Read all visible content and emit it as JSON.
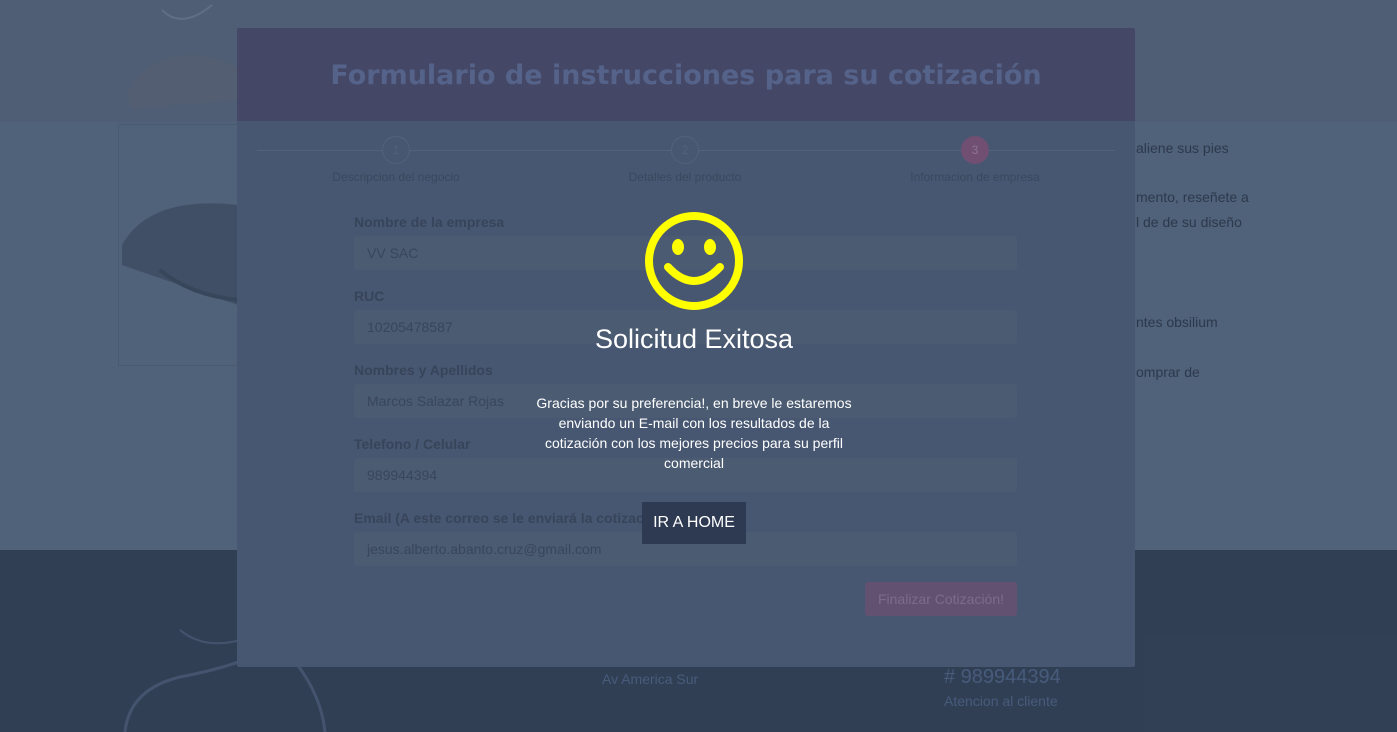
{
  "background": {
    "right_text": [
      "aliene sus pies",
      "mento, reseñete a",
      "l de de su diseño",
      "ntes obsilium",
      "omprar de"
    ],
    "address": "Av America Sur",
    "phone": "# 989944394",
    "attention": "Atencion al cliente"
  },
  "form": {
    "title": "Formulario de instrucciones para su cotización",
    "steps": [
      {
        "number": "1",
        "label": "Descripcion del negocio"
      },
      {
        "number": "2",
        "label": "Detalles del producto"
      },
      {
        "number": "3",
        "label": "Informacion de empresa"
      }
    ],
    "fields": {
      "company": {
        "label": "Nombre de la empresa",
        "value": "VV SAC"
      },
      "ruc": {
        "label": "RUC",
        "value": "10205478587"
      },
      "names": {
        "label": "Nombres y Apellidos",
        "value": "Marcos Salazar Rojas"
      },
      "phone": {
        "label": "Telefono / Celular",
        "value": "989944394"
      },
      "email": {
        "label": "Email (A este correo se le enviará la cotización)",
        "value": "jesus.alberto.abanto.cruz@gmail.com"
      }
    },
    "submit_label": "Finalizar Cotización!"
  },
  "modal": {
    "icon": "smiley-icon",
    "icon_color": "#ffff00",
    "title": "Solicitud Exitosa",
    "message": "Gracias por su preferencia!, en breve le estaremos enviando un E-mail con los resultados de la cotización con los mejores precios para su perfil comercial",
    "button_label": "IR A HOME"
  }
}
